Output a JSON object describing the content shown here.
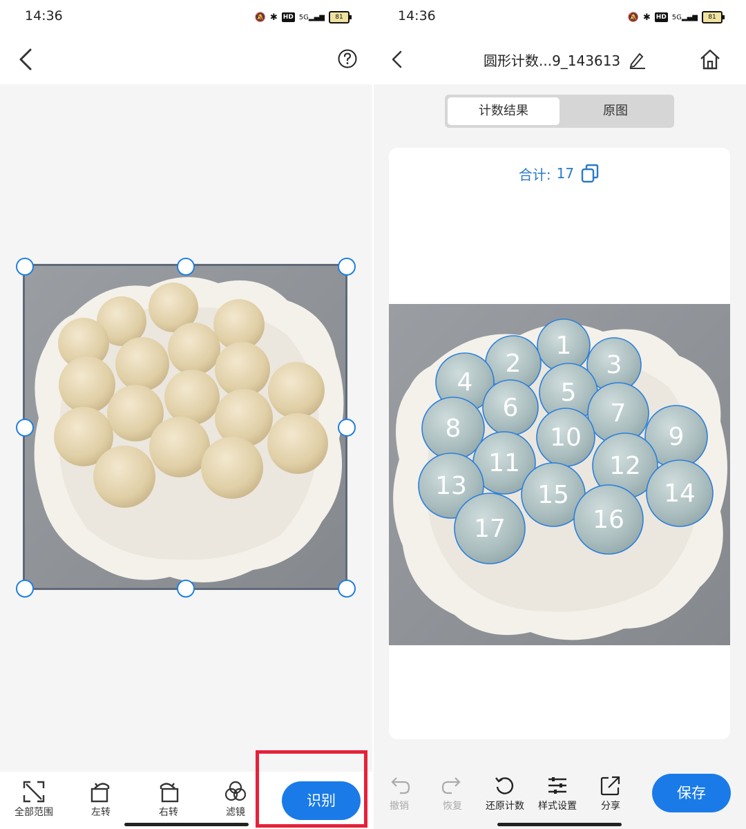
{
  "status": {
    "time": "14:36",
    "hd": "HD",
    "signal": "5G",
    "battery": "81"
  },
  "left": {
    "tools": [
      {
        "label": "全部范围",
        "icon": "expand-icon"
      },
      {
        "label": "左转",
        "icon": "rotate-left-icon"
      },
      {
        "label": "右转",
        "icon": "rotate-right-icon"
      },
      {
        "label": "滤镜",
        "icon": "filter-icon"
      }
    ],
    "recognize_label": "识别"
  },
  "right": {
    "title": "圆形计数...9_143613",
    "tabs": [
      {
        "label": "计数结果",
        "active": true
      },
      {
        "label": "原图",
        "active": false
      }
    ],
    "total_label": "合计:",
    "total_value": "17",
    "ball_numbers": [
      "1",
      "2",
      "3",
      "4",
      "5",
      "6",
      "7",
      "8",
      "9",
      "10",
      "11",
      "12",
      "13",
      "14",
      "15",
      "16",
      "17"
    ],
    "tools": [
      {
        "label": "撤销",
        "icon": "undo-icon",
        "enabled": false
      },
      {
        "label": "恢复",
        "icon": "redo-icon",
        "enabled": false
      },
      {
        "label": "还原计数",
        "icon": "reset-icon",
        "enabled": true
      },
      {
        "label": "样式设置",
        "icon": "sliders-icon",
        "enabled": true
      },
      {
        "label": "分享",
        "icon": "share-icon",
        "enabled": true
      }
    ],
    "save_label": "保存"
  },
  "colors": {
    "accent": "#1a7be8",
    "highlight": "#e5213a",
    "count_text": "#2a79c8"
  }
}
